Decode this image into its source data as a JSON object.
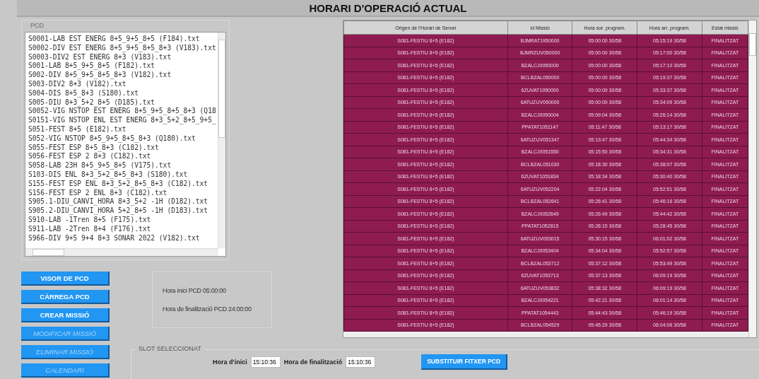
{
  "window": {
    "title": "HORARI D'OPERACIÓ ACTUAL"
  },
  "pcd_panel": {
    "title": "PCD",
    "files": [
      "S0001-LAB EST ENERG 8+5_9+5_8+5 (F184).txt",
      "S0002-DIV EST ENERG 8+5_9+5_8+5_8+3 (V183).txt",
      "S0003-DIV2 EST ENERG 8+3 (V183).txt",
      "S001-LAB 8+5_9+5_8+5 (F182).txt",
      "S002-DIV 8+5_9+5_8+5_8+3 (V182).txt",
      "S003-DIV2 8+3 (V182).txt",
      "S004-DIS 8+5_8+3 (S180).txt",
      "S005-DIU 8+3_5+2_8+5 (D185).txt",
      "S0052-VIG NSTOP EST ENERG 8+5_9+5_8+5_8+3 (Q18",
      "S0151-VIG NSTOP ENL EST ENERG 8+3_5+2_8+5_9+5_",
      "S051-FEST 8+5 (E182).txt",
      "S052-VIG NSTOP 8+5_9+5_8+5_8+3 (Q180).txt",
      "S055-FEST ESP 8+5_8+3 (C182).txt",
      "S056-FEST ESP 2 8+3 (C182).txt",
      "S058-LAB 23H 8+5_9+5_8+5 (V175).txt",
      "S103-DIS ENL 8+3_5+2_8+5_8+3 (S180).txt",
      "S155-FEST ESP ENL 8+3_5+2_8+5_8+3 (C182).txt",
      "S156-FEST ESP 2 ENL 8+3 (C182).txt",
      "S905.1-DIU_CANVI_HORA 8+3_5+2 -1H (D182).txt",
      "S905.2-DIU_CANVI_HORA 5+2_8+5 -1H (D183).txt",
      "S910-LAB -1Tren 8+5 (F175).txt",
      "S911-LAB -2Tren 8+4 (F176).txt",
      "S966-DIV 9+5 9+4 8+3 SONAR 2022 (V182).txt"
    ]
  },
  "buttons": [
    {
      "label": "VISOR DE PCD",
      "disabled": false
    },
    {
      "label": "CÀRREGA PCD",
      "disabled": false
    },
    {
      "label": "CREAR MISSIÓ",
      "disabled": false
    },
    {
      "label": "MODIFICAR MISSIÓ",
      "disabled": true
    },
    {
      "label": "ELIMINAR MISSIÓ",
      "disabled": true
    },
    {
      "label": "CALENDARI",
      "disabled": true
    }
  ],
  "pcd_info": [
    "Hora inici PCD 05:00:00",
    "Hora de finalització PCD 24:00:00"
  ],
  "table": {
    "columns": [
      "Origen de l'Horari de Servei",
      "Id Missió",
      "Hora sor. program.",
      "Hora arr. program.",
      "Estat missió"
    ],
    "rows": [
      [
        "S081-FESTIU 8+5 (E182)",
        "BJMRAT1950000",
        "05:00:00 30/58",
        "05:15:19 30/58",
        "FINALITZAT"
      ],
      [
        "S081-FESTIU 8+5 (E182)",
        "BJMRZUV050000",
        "05:00:00 30/58",
        "05:17:00 30/58",
        "FINALITZAT"
      ],
      [
        "S081-FESTIU 8+5 (E182)",
        "BZALCJ0050000",
        "05:00:00 30/58",
        "05:17:10 30/58",
        "FINALITZAT"
      ],
      [
        "S081-FESTIU 8+5 (E182)",
        "BCLBZAL050000",
        "05:00:00 30/58",
        "05:19:37 30/58",
        "FINALITZAT"
      ],
      [
        "S081-FESTIU 8+5 (E182)",
        "6ZUVAT1950000",
        "05:00:00 30/58",
        "05:33:37 30/58",
        "FINALITZAT"
      ],
      [
        "S081-FESTIU 8+5 (E182)",
        "6ATUZUV050000",
        "05:00:00 30/58",
        "05:34:09 30/58",
        "FINALITZAT"
      ],
      [
        "S081-FESTIU 8+5 (E182)",
        "BZALCJ0050004",
        "05:09:04 30/58",
        "05:26:14 30/58",
        "FINALITZAT"
      ],
      [
        "S081-FESTIU 8+5 (E182)",
        "PPATAT1051147",
        "05:11:47 30/58",
        "05:13:17 30/58",
        "FINALITZAT"
      ],
      [
        "S081-FESTIU 8+5 (E182)",
        "6ATUZUV051347",
        "05:13:47 30/58",
        "05:44:34 30/58",
        "FINALITZAT"
      ],
      [
        "S081-FESTIU 8+5 (E182)",
        "BZALCJ0051550",
        "05:15:50 30/58",
        "05:34:31 30/58",
        "FINALITZAT"
      ],
      [
        "S081-FESTIU 8+5 (E182)",
        "BCLBZAL051030",
        "05:18:30 30/58",
        "05:38:07 30/58",
        "FINALITZAT"
      ],
      [
        "S081-FESTIU 8+5 (E182)",
        "6ZUVAT1051834",
        "05:18:34 30/58",
        "05:30:40 30/58",
        "FINALITZAT"
      ],
      [
        "S081-FESTIU 8+5 (E182)",
        "6ATUZUV052204",
        "05:22:04 30/58",
        "05:52:51 30/58",
        "FINALITZAT"
      ],
      [
        "S081-FESTIU 8+5 (E182)",
        "BCLBZAL052641",
        "05:26:41 30/58",
        "05:46:16 30/58",
        "FINALITZAT"
      ],
      [
        "S081-FESTIU 8+5 (E182)",
        "BZALCJ0052649",
        "05:26:49 30/58",
        "05:44:42 30/58",
        "FINALITZAT"
      ],
      [
        "S081-FESTIU 8+5 (E182)",
        "PPATAT1052815",
        "05:28:15 30/58",
        "05:28:45 30/58",
        "FINALITZAT"
      ],
      [
        "S081-FESTIU 8+5 (E182)",
        "6ATUZUV053015",
        "05:30:15 30/58",
        "06:01:02 30/58",
        "FINALITZAT"
      ],
      [
        "S081-FESTIU 8+5 (E182)",
        "BZALCJ0053404",
        "05:34:04 30/58",
        "05:52:57 30/58",
        "FINALITZAT"
      ],
      [
        "S081-FESTIU 8+5 (E182)",
        "BCLBZAL053712",
        "05:37:12 30/58",
        "05:53:49 30/58",
        "FINALITZAT"
      ],
      [
        "S081-FESTIU 8+5 (E182)",
        "6ZUVAT1053713",
        "05:37:13 30/58",
        "06:09:19 30/58",
        "FINALITZAT"
      ],
      [
        "S081-FESTIU 8+5 (E182)",
        "6ATUZUV053832",
        "05:38:32 30/58",
        "06:09:19 30/58",
        "FINALITZAT"
      ],
      [
        "S081-FESTIU 8+5 (E182)",
        "BZALCJ0054221",
        "05:42:21 30/58",
        "06:01:14 30/58",
        "FINALITZAT"
      ],
      [
        "S081-FESTIU 8+5 (E182)",
        "PPATAT1054443",
        "05:44:43 30/58",
        "05:46:19 30/58",
        "FINALITZAT"
      ],
      [
        "S081-FESTIU 8+5 (E182)",
        "BCLBZAL054529",
        "05:45:29 30/58",
        "06:04:06 30/58",
        "FINALITZAT"
      ]
    ]
  },
  "slot": {
    "title": "SLOT SELECCIONAT",
    "start_label": "Hora d'inici",
    "start_value": "15:10:36",
    "end_label": "Hora de finalització",
    "end_value": "15:10:36",
    "button": "SUBSTITUIR FITXER PCD"
  }
}
